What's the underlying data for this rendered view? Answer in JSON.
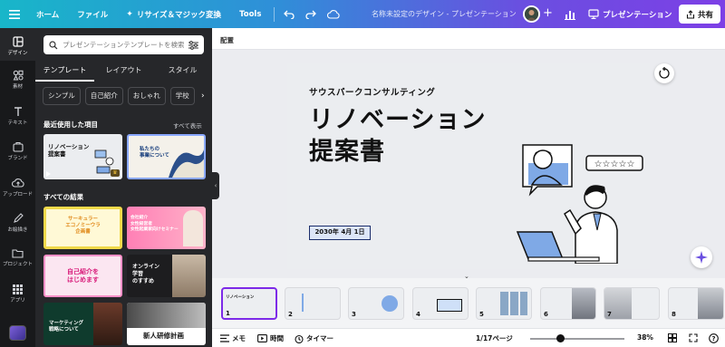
{
  "topbar": {
    "menu_icon": "hamburger-menu-icon",
    "home": "ホーム",
    "file": "ファイル",
    "resize": "リサイズ＆マジック変換",
    "tools": "Tools",
    "doc_title": "名称未設定のデザイン - プレゼンテーション",
    "present": "プレゼンテーション",
    "share": "共有"
  },
  "rail": [
    {
      "label": "デザイン",
      "icon": "layout-icon"
    },
    {
      "label": "素材",
      "icon": "elements-icon"
    },
    {
      "label": "テキスト",
      "icon": "text-icon"
    },
    {
      "label": "ブランド",
      "icon": "brand-icon"
    },
    {
      "label": "アップロード",
      "icon": "upload-cloud-icon"
    },
    {
      "label": "お絵描き",
      "icon": "draw-icon"
    },
    {
      "label": "プロジェクト",
      "icon": "folder-icon"
    },
    {
      "label": "アプリ",
      "icon": "apps-grid-icon"
    }
  ],
  "panel": {
    "search_placeholder": "プレゼンテーションテンプレートを検索",
    "tabs": [
      "テンプレート",
      "レイアウト",
      "スタイル"
    ],
    "chips": [
      "シンプル",
      "自己紹介",
      "おしゃれ",
      "学校"
    ],
    "recent_title": "最近使用した項目",
    "see_all": "すべて表示",
    "results_title": "すべての結果",
    "thumb_texts": {
      "recent1": "リノベーション\n提案書",
      "recent2": "私たちの\n事業について",
      "r1": "サーキュラー\nエコノミーウラ\n企画書",
      "r2": "会社紹介\n女性経営者\n女性起業家向けセミナー",
      "r3": "自己紹介を\nはじめます",
      "r4": "オンライン\n学習\nのすすめ",
      "r5": "マーケティング\n戦略について",
      "r6": "新人研修計画"
    }
  },
  "main": {
    "header_label": "配置"
  },
  "slide": {
    "subtitle": "サウスパークコンサルティング",
    "title_line1": "リノベーション",
    "title_line2": "提案書",
    "date": "2030年 4月 1日"
  },
  "pages": [
    {
      "num": "1"
    },
    {
      "num": "2"
    },
    {
      "num": "3"
    },
    {
      "num": "4"
    },
    {
      "num": "5"
    },
    {
      "num": "6"
    },
    {
      "num": "7"
    },
    {
      "num": "8"
    }
  ],
  "bottom": {
    "notes": "メモ",
    "time": "時間",
    "timer": "タイマー",
    "page_info": "1/17ページ",
    "zoom": "38%"
  },
  "colors": {
    "accent": "#7d2ae8",
    "date_border": "#1a2d6b",
    "illustration_blue": "#7fa9e6"
  }
}
